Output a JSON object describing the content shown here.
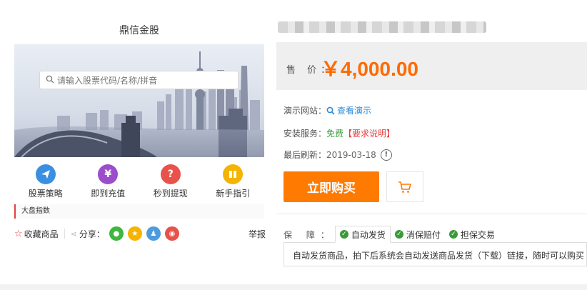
{
  "preview": {
    "app_title": "鼎信金股",
    "search_placeholder": "请输入股票代码/名称/拼音",
    "nav": [
      {
        "label": "股票策略",
        "icon": "paper-plane-icon",
        "color": "#3b8fe0"
      },
      {
        "label": "即到充值",
        "icon": "yen-icon",
        "color": "#9b4dca"
      },
      {
        "label": "秒到提现",
        "icon": "question-icon",
        "color": "#e8524a"
      },
      {
        "label": "新手指引",
        "icon": "book-icon",
        "color": "#f5b400"
      }
    ],
    "market_bar": "大盘指数"
  },
  "left_footer": {
    "favorite": "收藏商品",
    "share_label": "分享：",
    "report": "举报"
  },
  "product": {
    "price_label": "售 价：",
    "price": "￥4,000.00",
    "demo_label": "演示网站：",
    "demo_link": "查看演示",
    "install_label": "安装服务：",
    "install_free": "免费",
    "install_req": "【要求说明】",
    "refresh_label": "最后刷新：",
    "refresh_date": "2019-03-18",
    "buy_button": "立即购买",
    "guarantee_label": "保 障：",
    "guarantee_tabs": [
      "自动发货",
      "消保赔付",
      "担保交易"
    ],
    "guarantee_desc": "自动发货商品，拍下后系统会自动发送商品发货（下载）链接，随时可以购买"
  },
  "colors": {
    "accent": "#ff7a00",
    "price": "#ff6a00",
    "link": "#2d89d8",
    "free": "#3a9a3a",
    "alert": "#e53e3e"
  }
}
